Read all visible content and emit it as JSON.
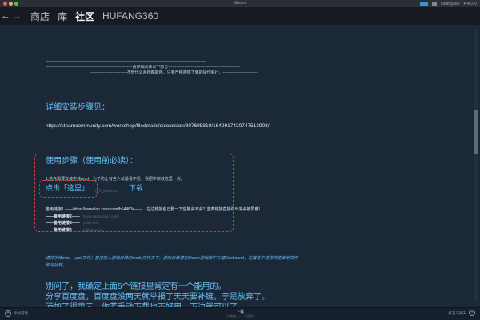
{
  "window": {
    "title": "Steam",
    "username": "hufang360",
    "balance": "¥ 45.00"
  },
  "nav": {
    "back": "←",
    "forward": "→",
    "links": [
      "商店",
      "库",
      "社区",
      "HUFANG360"
    ],
    "active_index": 2
  },
  "doc": {
    "divider_1": "------------------------------------------------------------------------------------------------------------------------",
    "notice_line": "-----------------------------------------------------------------请仔细阅读以下部分------------------------------------------------------",
    "warn_line": "----------------------------不管什么系统都能用，只要严格遵循下面的操作就行。--------------------------",
    "divider_2": "------------------------------------------------------------------------------------------------------------------------",
    "install_heading": "详细安装步骤见：",
    "install_url": "https://steamcommunity.com/workshop/filedetails/discussion/807695810/1649917420747513908/",
    "usage_heading": "使用步骤（使用前必读）：",
    "step1": "1.首先需要安装字体mod，为了防止有些人就是看不见，我把字体放这里一点。",
    "step1_faint": "(fzh_yahei.ttc)",
    "click_here": "点击「这里」",
    "download": "下载",
    "mirror_line": "备用链接1 ——https://www.lan zous.com/b644634——（左边链接自己删一下空格会不会？蓝奏链接直接跳出来会被屏蔽）",
    "mirror_2": "——备用链接2——",
    "mirror_2_faint": "(www.jianguoyun.com)",
    "mirror_3": "——备用链接3——",
    "mirror_3_faint": "(ctfile.net)",
    "mirror_4": "——备用链接4——",
    "mirror_4_faint": "(github.com)",
    "italic_para": "请将字体mod（.pak文件）直接放入游戏目录的mods文件夹下。游戏目录请在Steam游戏库中右键Starbound，在属性中选择浏览本地文件即可找到。",
    "closing_1": "别问了，我确定上面5个链接里肯定有一个能用的。",
    "closing_2": "分享百度盘，百度盘没两天就举报了天天要补链，于是放弃了。",
    "closing_3": "添加了很果元，你若手动下载也不好用，下边就可以了"
  },
  "bottom": {
    "add_game": "添加游戏",
    "downloads": "下载",
    "downloads_sub": "已完成 1 / 1 个项目",
    "friends": "好友与聊天"
  },
  "colors": {
    "accent": "#67c1f5",
    "background": "#1b2838",
    "highlight_box": "#d94040"
  }
}
